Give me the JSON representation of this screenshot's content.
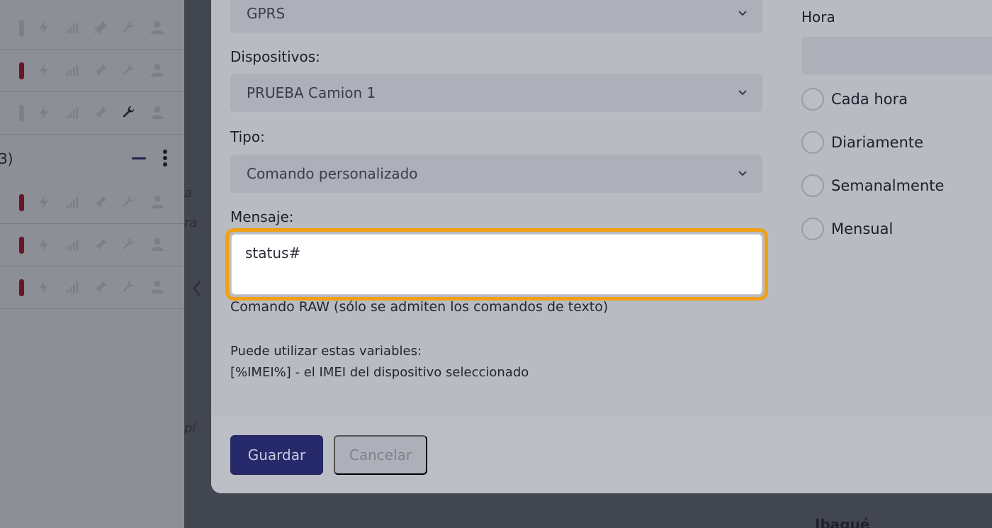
{
  "background": {
    "group_label": "3)",
    "map_city": "Ibagué",
    "map_fragments": [
      "a",
      "ra",
      "pí"
    ],
    "rows_top": [
      {
        "status": "gray"
      },
      {
        "status": "red"
      },
      {
        "status": "gray"
      }
    ],
    "rows_bottom": [
      {
        "status": "red"
      },
      {
        "status": "red"
      },
      {
        "status": "red"
      }
    ]
  },
  "modal": {
    "protocol_value": "GPRS",
    "devices_label": "Dispositivos:",
    "devices_value": "PRUEBA Camion 1",
    "type_label": "Tipo:",
    "type_value": "Comando personalizado",
    "message_label": "Mensaje:",
    "message_value": "status#",
    "message_helper": "Comando RAW (sólo se admiten los comandos de texto)",
    "vars_title": "Puede utilizar estas variables:",
    "vars_item": "[%IMEI%] - el IMEI del dispositivo seleccionado",
    "hora_label": "Hora",
    "radios": [
      "Cada hora",
      "Diariamente",
      "Semanalmente",
      "Mensual"
    ],
    "save_label": "Guardar",
    "cancel_label": "Cancelar"
  },
  "colors": {
    "accent": "#f0a015",
    "primary_button": "#262a6b",
    "status_red": "#6a1526"
  }
}
